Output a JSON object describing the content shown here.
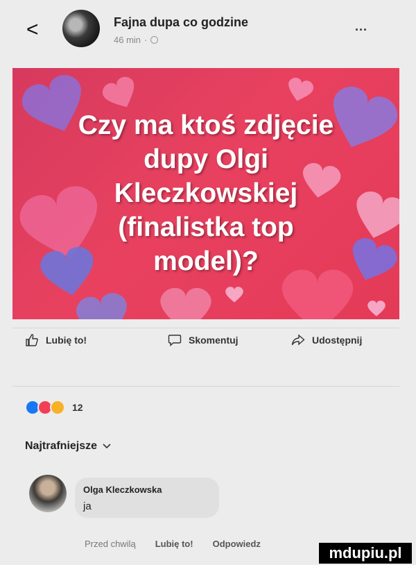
{
  "header": {
    "back_glyph": "<",
    "author": "Fajna dupa co godzine",
    "time": "46 min",
    "separator": "·",
    "more_label": "..."
  },
  "post": {
    "lines": [
      "Czy ma ktoś zdjęcie",
      "dupy Olgi",
      "Kleczkowskiej",
      "(finalistka top",
      "model)?"
    ],
    "background_color": "#e33a58"
  },
  "actions": {
    "like": "Lubię to!",
    "comment": "Skomentuj",
    "share": "Udostępnij"
  },
  "reactions": {
    "icons": [
      "like-icon",
      "love-icon",
      "haha-icon"
    ],
    "count": "12"
  },
  "comments_sort": "Najtrafniejsze",
  "comment": {
    "author": "Olga Kleczkowska",
    "text": "ja",
    "time": "Przed chwilą",
    "like": "Lubię to!",
    "reply": "Odpowiedz"
  },
  "watermark": "mdupiu.pl"
}
